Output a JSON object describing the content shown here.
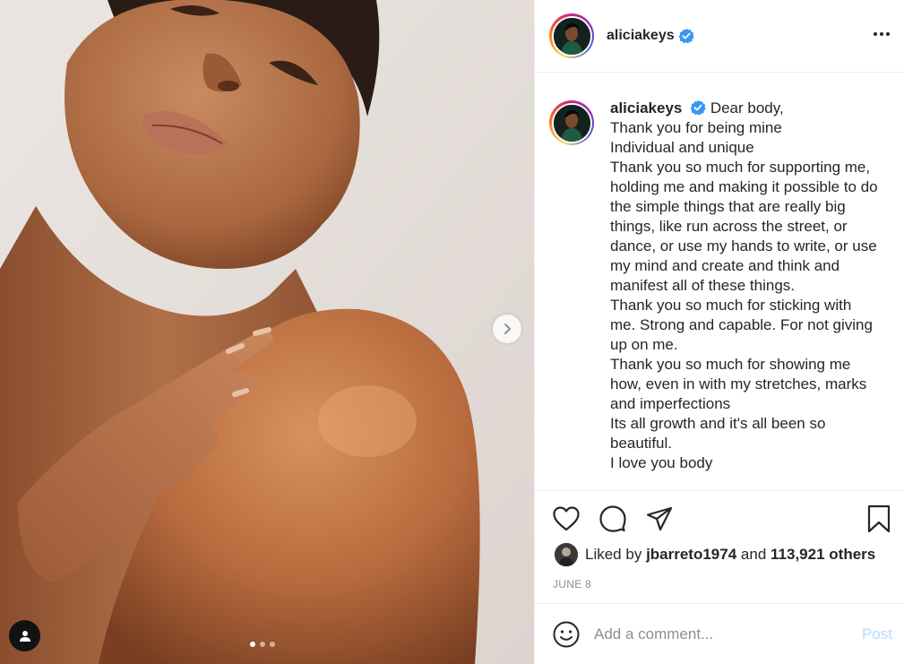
{
  "post": {
    "username": "aliciakeys",
    "verified": true,
    "caption_user": "aliciakeys",
    "caption": "Dear body,\nThank you for being mine\nIndividual and unique\nThank you so much for supporting me, holding me and making it possible to do the simple things that are really big things, like run across the street, or dance, or use my hands to write, or use my mind and create and think and manifest all of these things.\nThank you so much for sticking with me. Strong and capable. For not giving up on me.\nThank you so much for showing me how, even in with my stretches, marks and imperfections\nIts all growth and it's all been so beautiful.\nI love you body",
    "likes": {
      "prefix": "Liked by",
      "liker": "jbarreto1974",
      "and": "and",
      "others": "113,921 others"
    },
    "date": "JUNE 8",
    "carousel": {
      "count": 3,
      "active_index": 0
    }
  },
  "comment": {
    "placeholder": "Add a comment...",
    "post_label": "Post"
  },
  "icons": {
    "more": "more-horizontal-icon",
    "like": "heart-icon",
    "comment": "comment-bubble-icon",
    "share": "paper-plane-icon",
    "save": "bookmark-icon",
    "emoji": "smiley-icon",
    "next": "chevron-right-icon",
    "user_tag": "person-icon",
    "verified": "verified-badge-icon"
  },
  "colors": {
    "verified_blue": "#3897f0",
    "post_disabled": "#b3dbff",
    "text": "#262626",
    "muted": "#8e8e8e",
    "border": "#efefef"
  }
}
